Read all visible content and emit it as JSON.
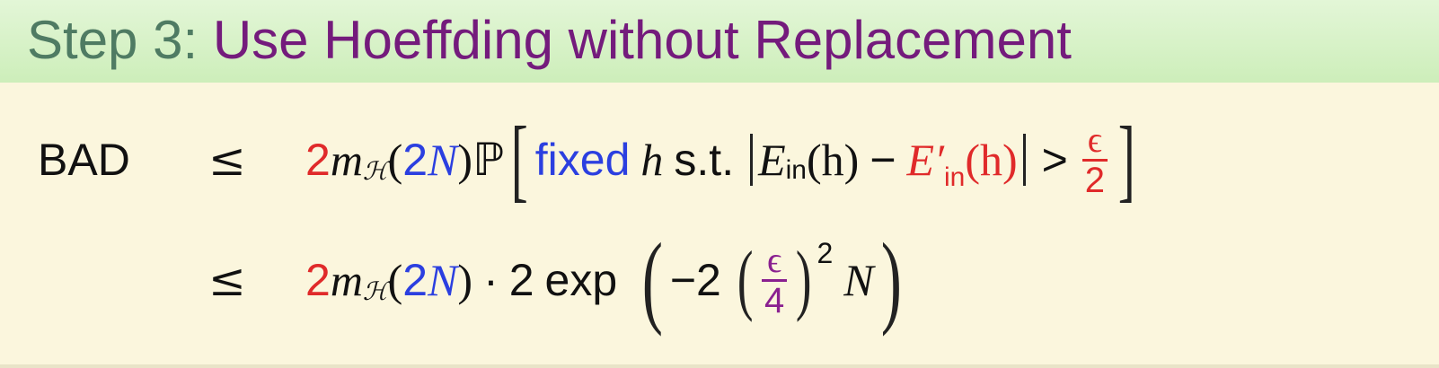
{
  "title": {
    "step": "Step 3:",
    "main": "Use Hoeffding without Replacement"
  },
  "lines": [
    {
      "lhs": "BAD",
      "relation": "≤",
      "coef": "2",
      "m": "m",
      "m_sub": "ℋ",
      "arg": "2N",
      "prob": "ℙ",
      "fixed": "fixed",
      "h": "h",
      "st": "s.t.",
      "Ein": "E",
      "Ein_sub": "in",
      "Ein_arg": "(h)",
      "minus": "−",
      "Ein2": "E′",
      "Ein2_sub": "in",
      "Ein2_arg": "(h)",
      "gt": ">",
      "frac_num": "ϵ",
      "frac_den": "2"
    },
    {
      "relation": "≤",
      "coef": "2",
      "m": "m",
      "m_sub": "ℋ",
      "arg": "2N",
      "dot": "·",
      "two": "2",
      "exp": "exp",
      "neg2": "−2",
      "frac_num": "ϵ",
      "frac_den": "4",
      "power": "2",
      "N": "N"
    }
  ],
  "colors": {
    "title_step": "#4f7b63",
    "title_main": "#741b7c",
    "red": "#e02a2a",
    "blue": "#2b3fe0",
    "purple": "#8a2090",
    "background": "#fbf6dd",
    "title_bar": "#cdeeba"
  }
}
